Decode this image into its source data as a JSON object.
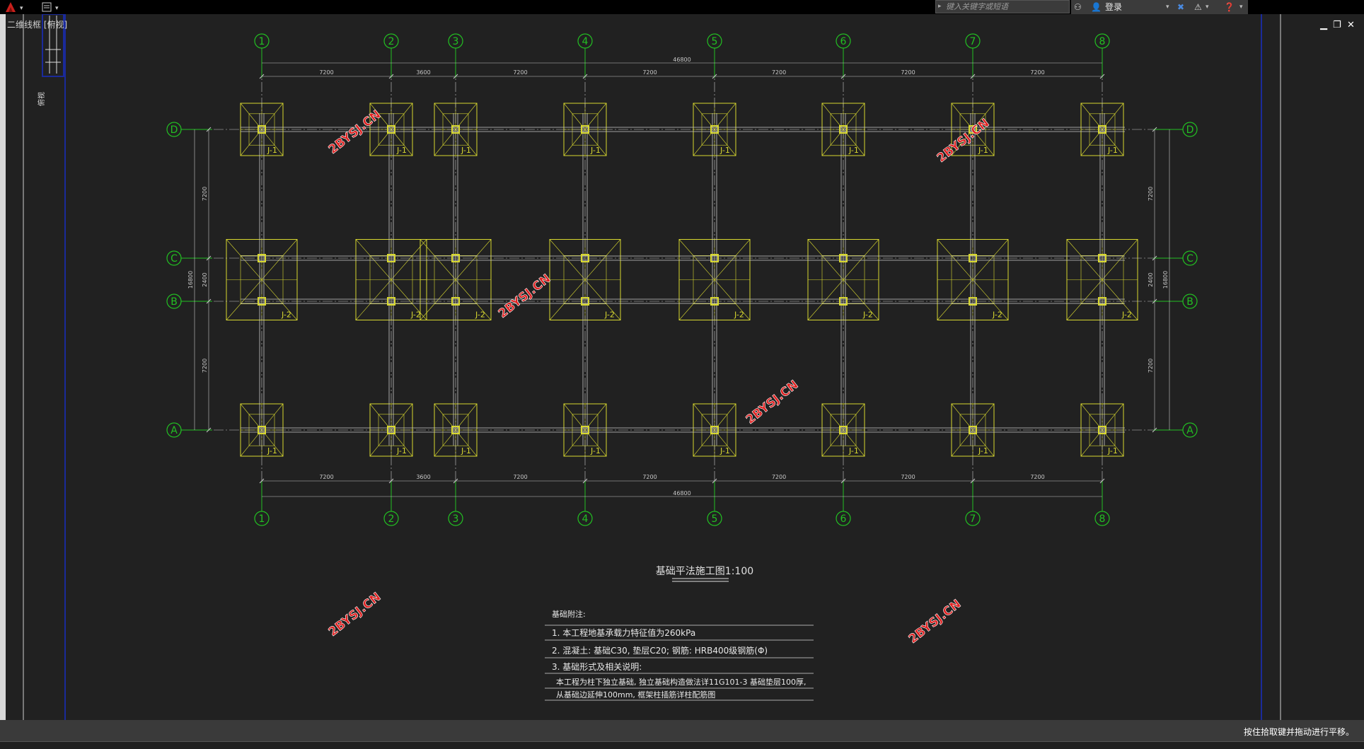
{
  "toolbar": {
    "search_placeholder": "键入关键字或短语",
    "login_label": "登录",
    "status_message": "按住拾取键并拖动进行平移。"
  },
  "viewport": {
    "corner_label": "二维线框 [俯视]",
    "side_label": "俯视"
  },
  "drawing": {
    "title": "基础平法施工图1:100",
    "column_axes": [
      "1",
      "2",
      "3",
      "4",
      "5",
      "6",
      "7",
      "8"
    ],
    "row_axes": [
      "D",
      "C",
      "B",
      "A"
    ],
    "top_spacings": [
      "7200",
      "3600",
      "7200",
      "7200",
      "7200",
      "7200",
      "7200"
    ],
    "bottom_spacings": [
      "7200",
      "3600",
      "7200",
      "7200",
      "7200",
      "7200",
      "7200"
    ],
    "total_width": "46800",
    "left_dims": [
      "7200",
      "2400",
      "7200"
    ],
    "left_total": "16800",
    "right_dims": [
      "7200",
      "2400",
      "7200"
    ],
    "right_total": "16800",
    "footing_label_1": "J-1",
    "footing_label_2": "J-2",
    "watermark": "2BYSJ.CN",
    "notes": {
      "heading": "基础附注:",
      "line1": "1. 本工程地基承载力特征值为260kPa",
      "line2": "2. 混凝土: 基础C30, 垫层C20; 钢筋: HRB400级钢筋(Φ)",
      "line3": "3. 基础形式及相关说明:",
      "line4": "本工程为柱下独立基础, 独立基础构造做法详11G101-3 基础垫层100厚,",
      "line5": "从基础边延伸100mm, 框架柱插筋详柱配筋图"
    }
  },
  "colors": {
    "axis_green": "#22c022",
    "footing_yellow": "#d8d830",
    "dim_gray": "#c8c8c8",
    "watermark_red": "#e02020",
    "border_blue": "#1a2a9a"
  }
}
